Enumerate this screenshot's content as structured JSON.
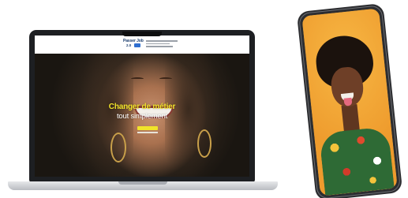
{
  "laptop": {
    "site": {
      "logo": {
        "line1": "Passer Job",
        "line2": "2.0"
      },
      "hero": {
        "title": "Changer de métier",
        "subtitle": "tout simplement"
      }
    }
  },
  "colors": {
    "accent_yellow": "#f1e32a",
    "brand_navy": "#1b3d6e",
    "phone_background": "#f2a93c"
  }
}
